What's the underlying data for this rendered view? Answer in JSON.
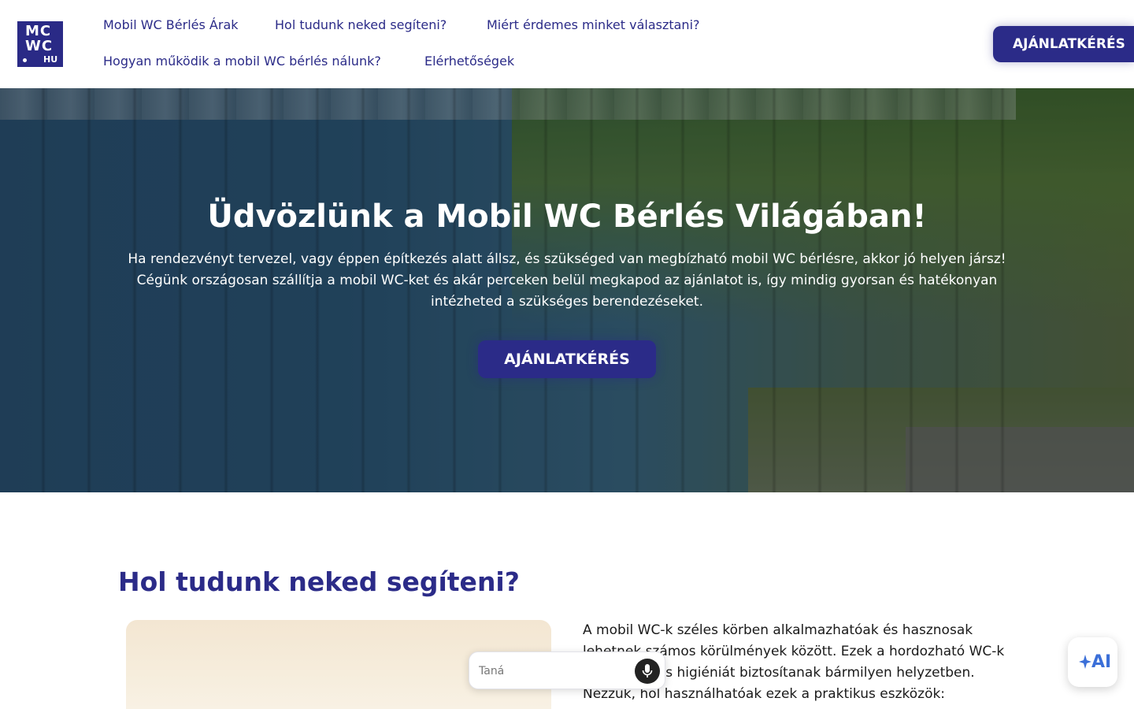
{
  "header": {
    "logo": {
      "line1": "MC",
      "line2": "WC",
      "line3": "HU"
    },
    "nav": [
      {
        "label": "Mobil WC Bérlés Árak"
      },
      {
        "label": "Hol tudunk neked segíteni?"
      },
      {
        "label": "Miért érdemes minket választani?"
      },
      {
        "label": "Hogyan működik a mobil WC bérlés nálunk?"
      },
      {
        "label": "Elérhetőségek"
      }
    ],
    "cta_label": "AJÁNLATKÉRÉS"
  },
  "hero": {
    "title": "Üdvözlünk a Mobil WC Bérlés Világában!",
    "text": "Ha rendezvényt tervezel, vagy éppen építkezés alatt állsz, és szükséged van megbízható mobil WC bérlésre, akkor jó helyen jársz! Cégünk országosan szállítja a mobil WC-ket és akár perceken belül megkapod az ajánlatot is, így mindig gyorsan és hatékonyan intézheted a szükséges berendezéseket.",
    "cta_label": "AJÁNLATKÉRÉS"
  },
  "section": {
    "title": "Hol tudunk neked segíteni?",
    "text": "A mobil WC-k széles körben alkalmazhatóak és hasznosak lehetnek számos körülmények között. Ezek a hordozható WC-k kényelmet és higiéniát biztosítanak bármilyen helyzetben. Nézzük, hol használhatóak ezek a praktikus eszközök:"
  },
  "chat": {
    "placeholder": "Taná",
    "mic_icon": "microphone-icon"
  },
  "ai_button": {
    "label": "AI",
    "icon": "sparkle-icon"
  },
  "colors": {
    "brand": "#2b2b88",
    "ai_accent": "#3b6fd8"
  }
}
